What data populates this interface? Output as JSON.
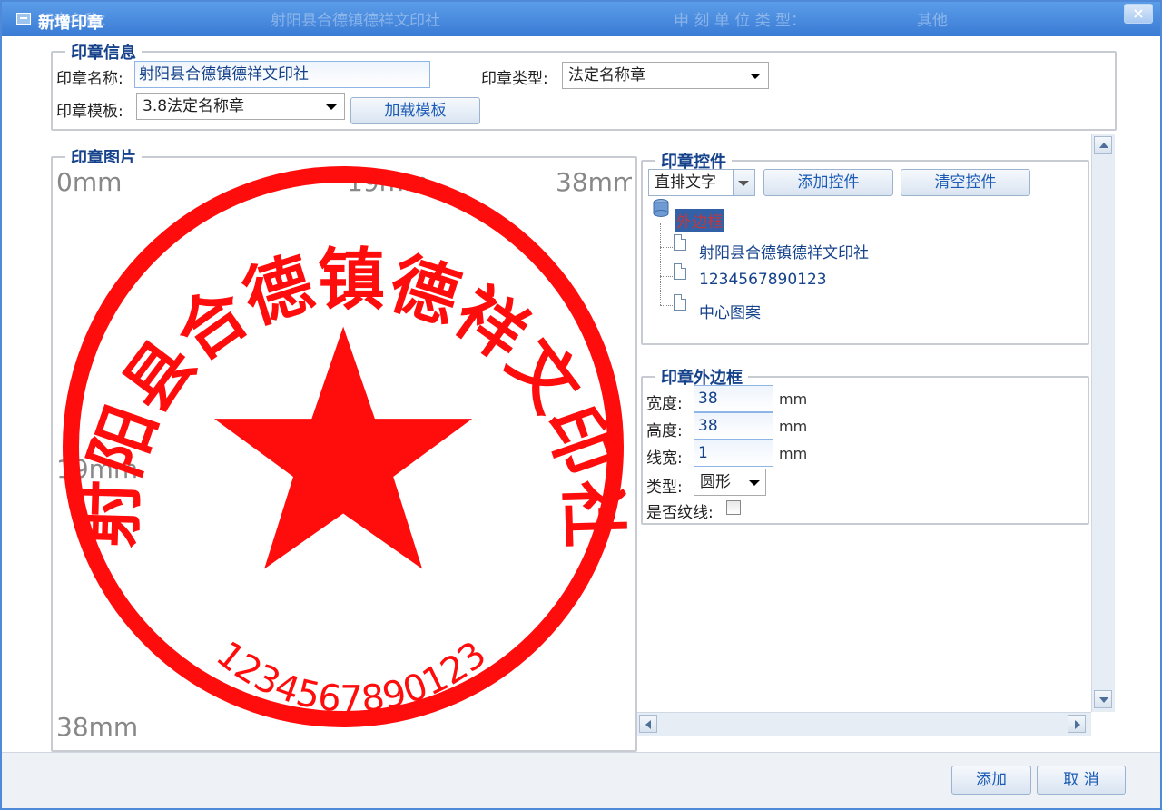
{
  "window": {
    "title": "新增印章",
    "close_label": "×",
    "ghost": {
      "name_label": "印章名称：",
      "name_value": "射阳县合德镇德祥文印社",
      "unit_type_label": "申 刻 单 位 类 型：",
      "unit_type_value": "其他"
    }
  },
  "seal_info": {
    "legend": "印章信息",
    "name_label": "印章名称:",
    "name_value": "射阳县合德镇德祥文印社",
    "type_label": "印章类型:",
    "type_value": "法定名称章",
    "template_label": "印章模板:",
    "template_value": "3.8法定名称章",
    "load_template_button": "加载模板"
  },
  "seal_image": {
    "legend": "印章图片",
    "ruler": {
      "top_left": "0mm",
      "top_mid": "19mm",
      "top_right": "38mm",
      "left_mid": "19mm",
      "bottom_left": "38mm"
    },
    "stamp": {
      "arc_text": "射阳县合德镇德祥文印社",
      "number_text": "1234567890123",
      "color": "#ff0d0d"
    }
  },
  "controls": {
    "legend": "印章控件",
    "control_type_value": "直排文字",
    "add_control_button": "添加控件",
    "clear_control_button": "清空控件",
    "tree": {
      "root_label": "外边框",
      "items": [
        "射阳县合德镇德祥文印社",
        "1234567890123",
        "中心图案"
      ]
    }
  },
  "border": {
    "legend": "印章外边框",
    "width_label": "宽度:",
    "width_value": "38",
    "height_label": "高度:",
    "height_value": "38",
    "line_width_label": "线宽:",
    "line_width_value": "1",
    "unit": "mm",
    "type_label": "类型:",
    "type_value": "圆形",
    "pattern_label": "是否纹线:",
    "pattern_checked": false
  },
  "footer": {
    "add_button": "添加",
    "cancel_button": "取 消"
  },
  "colors": {
    "accent": "#15428b",
    "title_bar": "#3a7bd5",
    "stamp_red": "#ff0d0d"
  }
}
